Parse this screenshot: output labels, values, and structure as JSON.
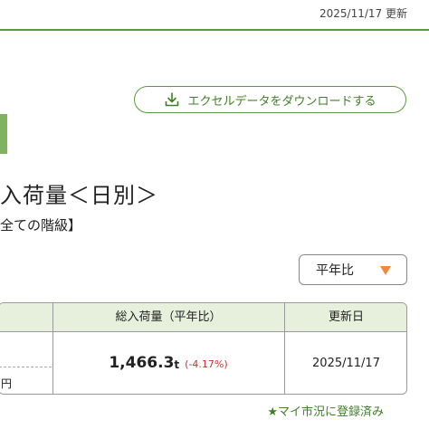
{
  "header": {
    "update_text": "2025/11/17 更新"
  },
  "download_button": {
    "label": "エクセルデータをダウンロードする",
    "icon": "download-icon"
  },
  "page": {
    "title": "入荷量＜日別＞",
    "subtitle": "全ての階級】"
  },
  "select": {
    "value": "平年比",
    "arrow_color": "#f08a3c"
  },
  "table": {
    "headers": [
      "総入荷量（平年比）",
      "更新日"
    ],
    "rows": [
      {
        "left_cell": "円",
        "quantity": "1,466.3",
        "unit": "t",
        "change": "(-4.17%)",
        "updated": "2025/11/17"
      }
    ]
  },
  "market_link": {
    "label": "★マイ市況に登録済み"
  },
  "colors": {
    "accent": "#5a9a3c",
    "header_bg": "#e6f0dc",
    "negative": "#d03030"
  }
}
